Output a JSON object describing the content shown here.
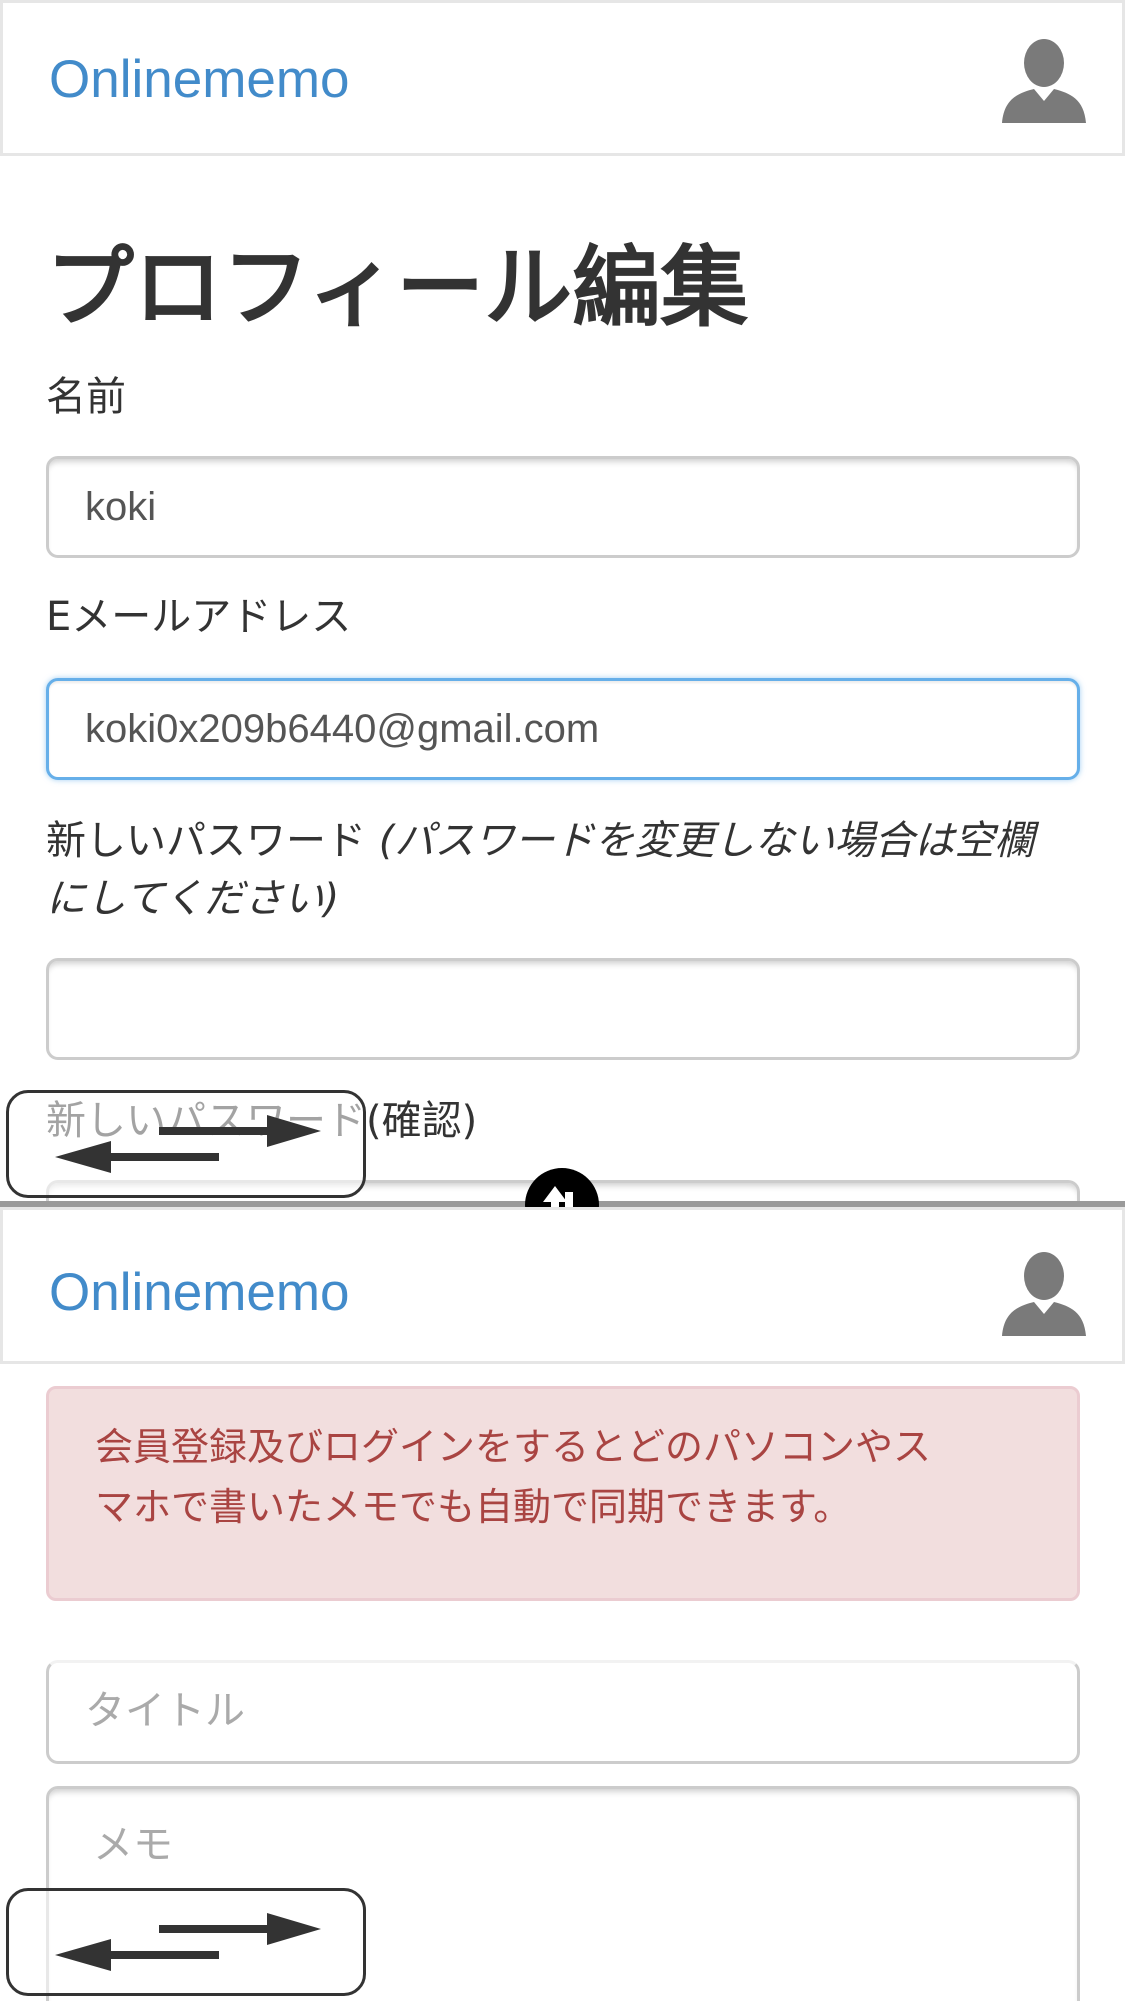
{
  "top_panel": {
    "navbar": {
      "brand": "Onlinememo",
      "avatar_icon": "user-icon"
    },
    "page_title": "プロフィール編集",
    "form": {
      "name_label": "名前",
      "name_value": "koki",
      "email_label": "Eメールアドレス",
      "email_value": "koki0x209b6440@gmail.com",
      "password_label": "新しいパスワード",
      "password_hint_line1": "(パスワードを変更しない場合は空欄",
      "password_hint_line2": "にしてください)",
      "password_value": "",
      "password_confirm_label": "新しいパスワード(確認)"
    },
    "overlay_icon": "swap-arrows-icon"
  },
  "divider": {
    "handle_icon": "resize-vertical-icon"
  },
  "bottom_panel": {
    "navbar": {
      "brand": "Onlinememo",
      "avatar_icon": "user-icon"
    },
    "alert": {
      "line1": "会員登録及びログインをするとどのパソコンやス",
      "line2": "マホで書いたメモでも自動で同期できます。"
    },
    "title_input": {
      "placeholder": "タイトル",
      "value": ""
    },
    "memo_input": {
      "placeholder": "メモ",
      "value": ""
    },
    "overlay_icon": "swap-arrows-icon"
  },
  "colors": {
    "brand": "#428bca",
    "alert_bg": "#f2dede",
    "alert_text": "#a94442",
    "focus_border": "#66afe9"
  }
}
